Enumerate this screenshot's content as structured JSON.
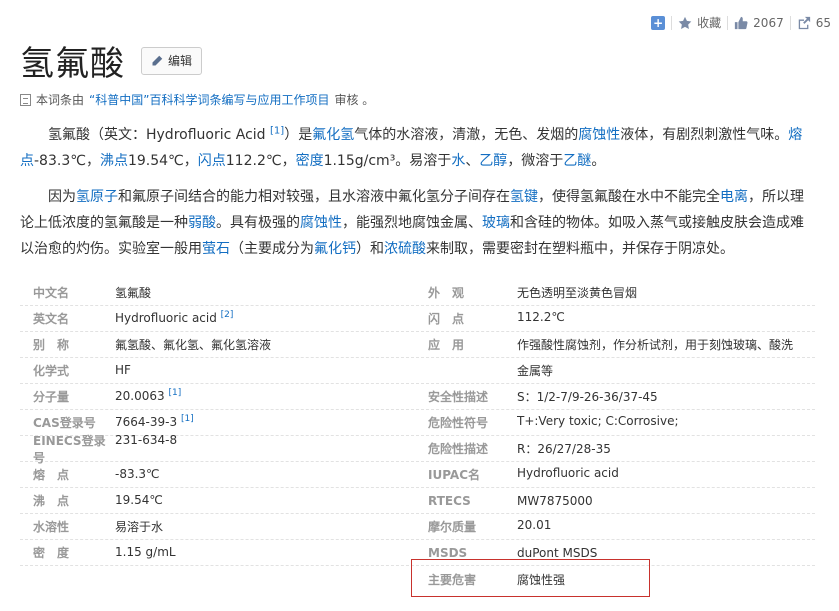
{
  "toolbar": {
    "collect_label": "收藏",
    "like_count": "2067",
    "share_count": "65"
  },
  "title": "氢氟酸",
  "edit_label": "编辑",
  "review": {
    "prefix": "本词条由",
    "link": "“科普中国”百科科学词条编写与应用工作项目",
    "suffix": " 审核 。"
  },
  "paragraph1": {
    "t1": "氢氟酸（英文：Hydrofluoric Acid ",
    "ref": "[1]",
    "t2": "）是",
    "l1": "氟化氢",
    "t3": "气体的水溶液，清澈，无色、发烟的",
    "l2": "腐蚀性",
    "t4": "液体，有剧烈刺激性气味。",
    "l3": "熔点",
    "t5": "-83.3℃，",
    "l4": "沸点",
    "t6": "19.54℃，",
    "l5": "闪点",
    "t7": "112.2℃，",
    "l6": "密度",
    "t8": "1.15g/cm³。易溶于",
    "l7": "水",
    "t9": "、",
    "l8": "乙醇",
    "t10": "，微溶于",
    "l9": "乙醚",
    "t11": "。"
  },
  "paragraph2": {
    "t1": "因为",
    "l1": "氢原子",
    "t2": "和氟原子间结合的能力相对较强，且水溶液中氟化氢分子间存在",
    "l2": "氢键",
    "t3": "，使得氢氟酸在水中不能完全",
    "l3": "电离",
    "t4": "，所以理论上低浓度的氢氟酸是一种",
    "l4": "弱酸",
    "t5": "。具有极强的",
    "l5": "腐蚀性",
    "t6": "，能强烈地腐蚀金属、",
    "l6": "玻璃",
    "t7": "和含硅的物体。如吸入蒸气或接触皮肤会造成难以治愈的灼伤。实验室一般用",
    "l7": "萤石",
    "t8": "（主要成分为",
    "l8": "氟化钙",
    "t9": "）和",
    "l9": "浓硫酸",
    "t10": "来制取，需要密封在塑料瓶中，并保存于阴凉处。"
  },
  "info_rows": [
    {
      "l_label": "中文名",
      "l_value": "氢氟酸",
      "l_ref": "",
      "r_label": "外　观",
      "r_value": "无色透明至淡黄色冒烟"
    },
    {
      "l_label": "英文名",
      "l_value": "Hydrofluoric acid",
      "l_ref": "[2]",
      "r_label": "闪　点",
      "r_value": "112.2℃"
    },
    {
      "l_label": "别　称",
      "l_value": "氟氢酸、氟化氢、氟化氢溶液",
      "l_ref": "",
      "r_label": "应　用",
      "r_value": "作强酸性腐蚀剂，作分析试剂，用于刻蚀玻璃、酸洗"
    },
    {
      "l_label": "化学式",
      "l_value": "HF",
      "l_ref": "",
      "r_label": "",
      "r_value": "金属等"
    },
    {
      "l_label": "分子量",
      "l_value": "20.0063",
      "l_ref": "[1]",
      "r_label": "安全性描述",
      "r_value": "S：1/2-7/9-26-36/37-45"
    },
    {
      "l_label": "CAS登录号",
      "l_value": "7664-39-3",
      "l_ref": "[1]",
      "r_label": "危险性符号",
      "r_value": "T+:Very toxic; C:Corrosive;"
    },
    {
      "l_label": "EINECS登录号",
      "l_value": "231-634-8",
      "l_ref": "",
      "r_label": "危险性描述",
      "r_value": "R：26/27/28-35"
    },
    {
      "l_label": "熔　点",
      "l_value": "-83.3℃",
      "l_ref": "",
      "r_label": "IUPAC名",
      "r_value": "Hydrofluoric acid"
    },
    {
      "l_label": "沸　点",
      "l_value": "19.54℃",
      "l_ref": "",
      "r_label": "RTECS",
      "r_value": "MW7875000"
    },
    {
      "l_label": "水溶性",
      "l_value": "易溶于水",
      "l_ref": "",
      "r_label": "摩尔质量",
      "r_value": "20.01"
    },
    {
      "l_label": "密　度",
      "l_value": "1.15 g/mL",
      "l_ref": "",
      "r_label": "MSDS",
      "r_value": "duPont MSDS"
    },
    {
      "l_label": "",
      "l_value": "",
      "l_ref": "",
      "r_label": "主要危害",
      "r_value": "腐蚀性强"
    }
  ],
  "icons": [
    "plus-icon",
    "star-icon",
    "thumb-up-icon",
    "share-icon",
    "pencil-icon",
    "document-icon"
  ],
  "colors": {
    "link": "#136ec2",
    "highlight": "#c8322d",
    "label": "#999999"
  }
}
